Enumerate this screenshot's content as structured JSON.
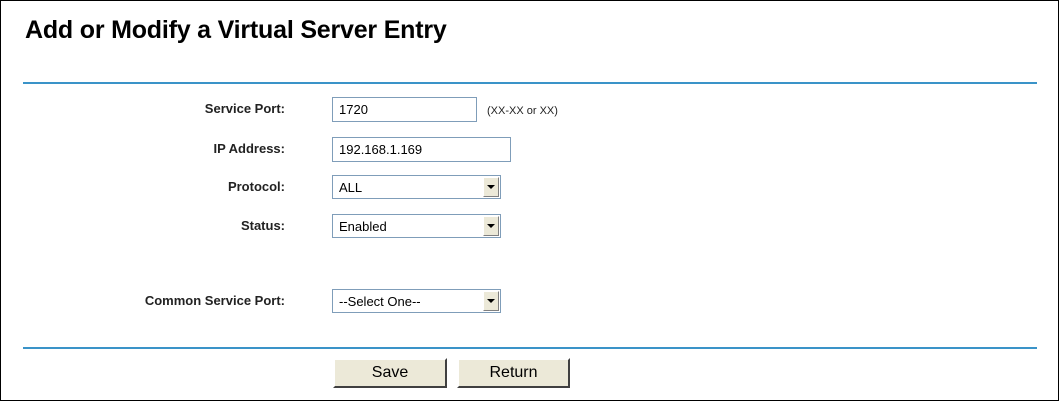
{
  "page": {
    "title": "Add or Modify a Virtual Server Entry"
  },
  "form": {
    "service_port": {
      "label": "Service Port:",
      "value": "1720",
      "hint": "(XX-XX or XX)"
    },
    "ip_address": {
      "label": "IP Address:",
      "value": "192.168.1.169"
    },
    "protocol": {
      "label": "Protocol:",
      "selected": "ALL"
    },
    "status": {
      "label": "Status:",
      "selected": "Enabled"
    },
    "common_service_port": {
      "label": "Common Service Port:",
      "selected": "--Select One--"
    }
  },
  "buttons": {
    "save_label": "Save",
    "return_label": "Return"
  },
  "colors": {
    "divider": "#3a93c8",
    "input_border": "#7f9db9",
    "button_face": "#ece9d8"
  }
}
